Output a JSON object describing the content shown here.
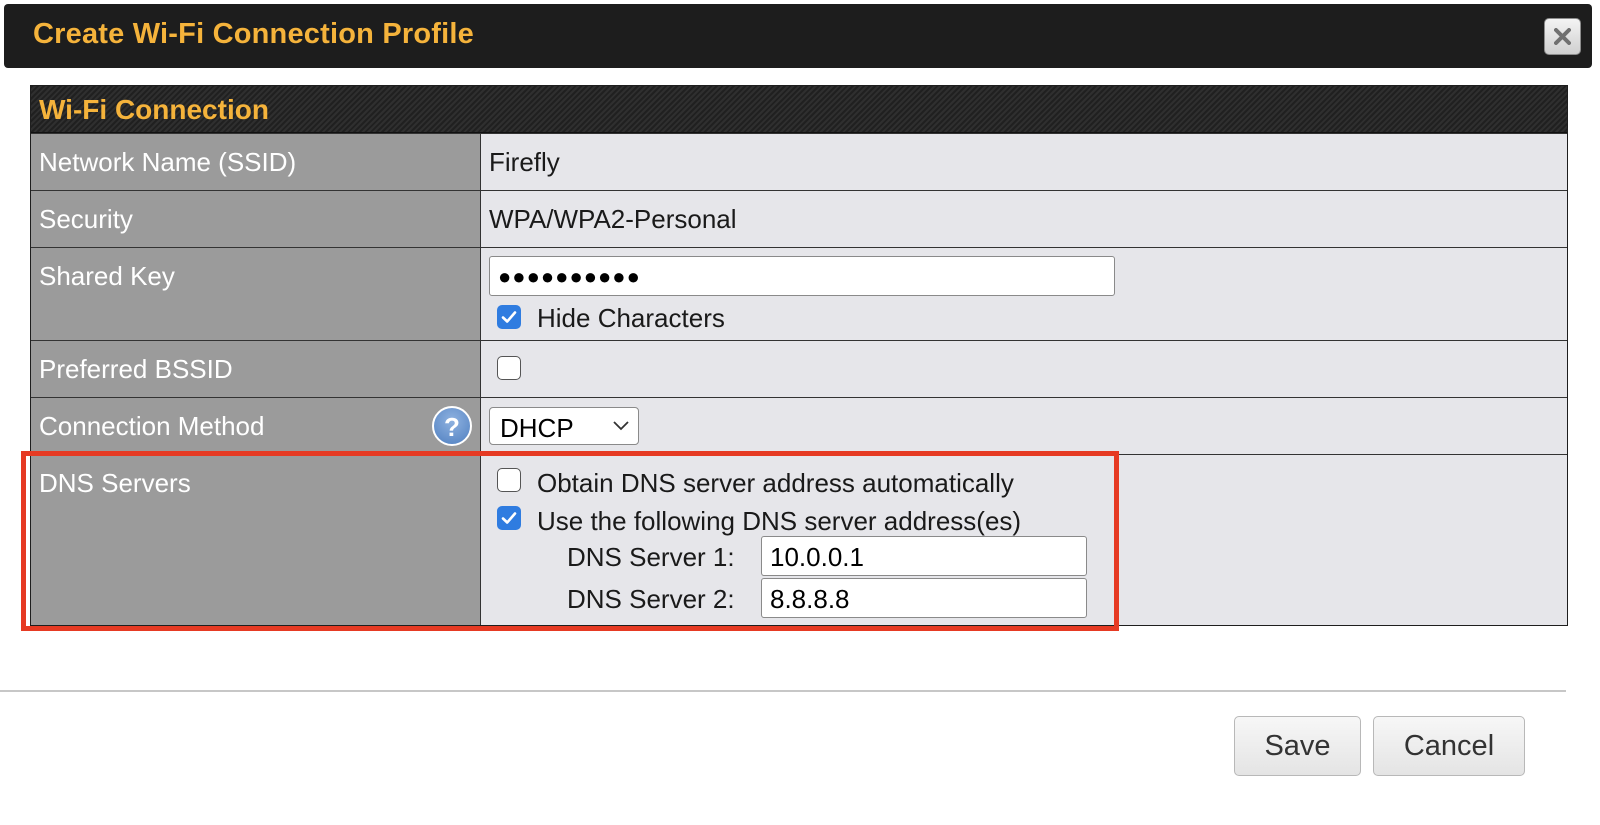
{
  "dialog": {
    "title": "Create Wi-Fi Connection Profile",
    "close_icon": "close-icon"
  },
  "section": {
    "title": "Wi-Fi Connection"
  },
  "rows": {
    "ssid": {
      "label": "Network Name (SSID)",
      "value": "Firefly"
    },
    "security": {
      "label": "Security",
      "value": "WPA/WPA2-Personal"
    },
    "shared_key": {
      "label": "Shared Key",
      "value": "●●●●●●●●●●",
      "hide_characters_label": "Hide Characters",
      "hide_characters_checked": true
    },
    "preferred_bssid": {
      "label": "Preferred BSSID",
      "checked": false
    },
    "connection_method": {
      "label": "Connection Method",
      "help_icon": "question-mark-icon",
      "help_glyph": "?",
      "selected": "DHCP"
    },
    "dns": {
      "label": "DNS Servers",
      "auto_label": "Obtain DNS server address automatically",
      "auto_checked": false,
      "manual_label": "Use the following DNS server address(es)",
      "manual_checked": true,
      "server1_label": "DNS Server 1:",
      "server1_value": "10.0.0.1",
      "server2_label": "DNS Server 2:",
      "server2_value": "8.8.8.8"
    }
  },
  "footer": {
    "save_label": "Save",
    "cancel_label": "Cancel"
  },
  "colors": {
    "title_text": "#f5b33b",
    "titlebar_bg": "#1d1d1d",
    "key_bg": "#9b9b9b",
    "value_bg": "#e6e6ea",
    "checkbox_checked": "#2f7ce0",
    "highlight_border": "#e63a23"
  }
}
